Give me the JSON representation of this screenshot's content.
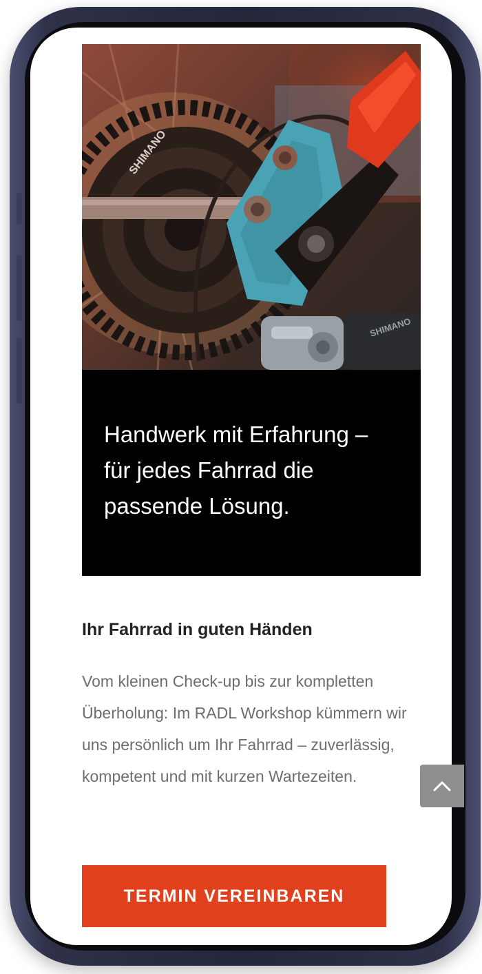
{
  "hero": {
    "image": "bicycle-cassette-and-cable-cutter-photo",
    "brand_texts": [
      "SHIMANO",
      "SHIMANO"
    ],
    "colors": {
      "tool_red": "#e03a1e",
      "brake_blue": "#4aa3b5"
    }
  },
  "caption": {
    "text": "Handwerk mit Erfahrung – für jedes Fahrrad die passende Lösung."
  },
  "section": {
    "title": "Ihr Fahrrad in guten Händen",
    "body": "Vom kleinen Check-up bis zur kompletten Überholung: Im RADL Workshop kümmern wir uns persönlich um Ihr Fahrrad – zuverlässig, kompetent und mit kurzen Wartezeiten."
  },
  "cta": {
    "label": "TERMIN VEREINBAREN",
    "color": "#e0401c"
  },
  "scroll_top": {
    "icon": "chevron-up-icon"
  }
}
